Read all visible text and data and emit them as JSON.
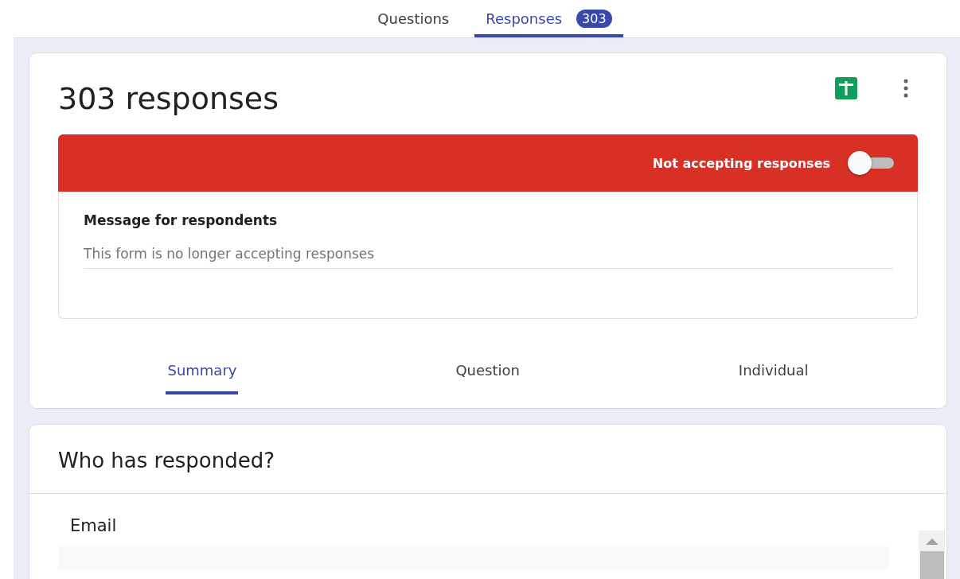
{
  "top_tabs": [
    {
      "label": "Questions",
      "selected": false
    },
    {
      "label": "Responses",
      "selected": true,
      "count": "303"
    }
  ],
  "summary_card": {
    "title": "303 responses",
    "banner": {
      "label": "Not accepting responses",
      "on": false
    },
    "message": {
      "label": "Message for respondents",
      "placeholder": "This form is no longer accepting responses"
    }
  },
  "view_tabs": [
    {
      "label": "Summary",
      "selected": true
    },
    {
      "label": "Question",
      "selected": false
    },
    {
      "label": "Individual",
      "selected": false
    }
  ],
  "respondents_card": {
    "title": "Who has responded?",
    "field_label": "Email"
  }
}
